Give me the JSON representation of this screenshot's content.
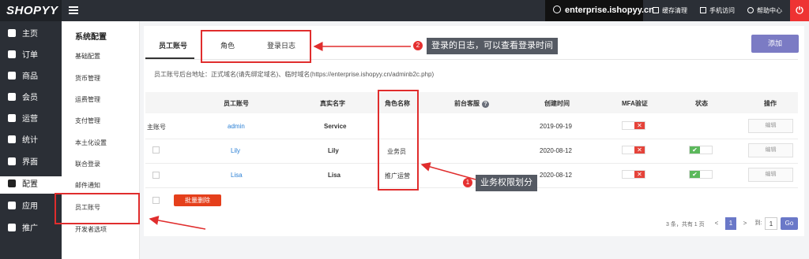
{
  "topbar": {
    "logo": "SHOPYY",
    "domain": "enterprise.ishopyy.cn",
    "links": [
      "缓存清理",
      "手机访问",
      "帮助中心"
    ],
    "power_icon": "power-icon"
  },
  "main_nav": [
    {
      "label": "主页",
      "icon": "home-icon"
    },
    {
      "label": "订单",
      "icon": "order-icon"
    },
    {
      "label": "商品",
      "icon": "box-icon"
    },
    {
      "label": "会员",
      "icon": "user-icon"
    },
    {
      "label": "运营",
      "icon": "megaphone-icon"
    },
    {
      "label": "统计",
      "icon": "bar-chart-icon"
    },
    {
      "label": "界面",
      "icon": "monitor-icon"
    },
    {
      "label": "配置",
      "icon": "gear-icon"
    },
    {
      "label": "应用",
      "icon": "puzzle-icon"
    },
    {
      "label": "推广",
      "icon": "send-icon"
    }
  ],
  "sub_nav": {
    "title": "系统配置",
    "items": [
      "基础配置",
      "货币管理",
      "运费管理",
      "支付管理",
      "本土化设置",
      "联合登录",
      "邮件通知",
      "员工账号",
      "开发者选项"
    ],
    "active": "员工账号"
  },
  "tabs": [
    "员工账号",
    "角色",
    "登录日志"
  ],
  "add_button": "添加",
  "address_line": "员工账号后台地址：正式域名(请先绑定域名)、临时域名(https://enterprise.ishopyy.cn/adminb2c.php)",
  "table": {
    "headers": [
      "员工账号",
      "真实名字",
      "角色名称",
      "前台客服",
      "创建时间",
      "MFA验证",
      "状态",
      "操作"
    ],
    "rows": [
      {
        "prefix": "主账号",
        "account": "admin",
        "name": "Service",
        "role": "",
        "created": "2019-09-19",
        "edit": "编辑"
      },
      {
        "prefix": "",
        "account": "Lily",
        "name": "Lily",
        "role": "业务员",
        "created": "2020-08-12",
        "edit": "编辑"
      },
      {
        "prefix": "",
        "account": "Lisa",
        "name": "Lisa",
        "role": "推广运营",
        "created": "2020-08-12",
        "edit": "编辑"
      }
    ],
    "mfa_off": "✕",
    "status_on": "✔",
    "bulk_delete": "批量删除"
  },
  "pagination": {
    "summary": "3 条，共有 1 页",
    "prev": "<",
    "current": "1",
    "next": ">",
    "goto_label": "到:",
    "goto_value": "1",
    "go": "Go"
  },
  "annotations": [
    {
      "number": "2",
      "text": "登录的日志，可以查看登录时间"
    },
    {
      "number": "1",
      "text": "业务权限划分"
    }
  ],
  "colors": {
    "accent": "#7b7bc4",
    "annotation_red": "#e02d2d",
    "link": "#2a7fd4",
    "danger": "#e53f1b",
    "sidebar": "#2b2f36"
  }
}
